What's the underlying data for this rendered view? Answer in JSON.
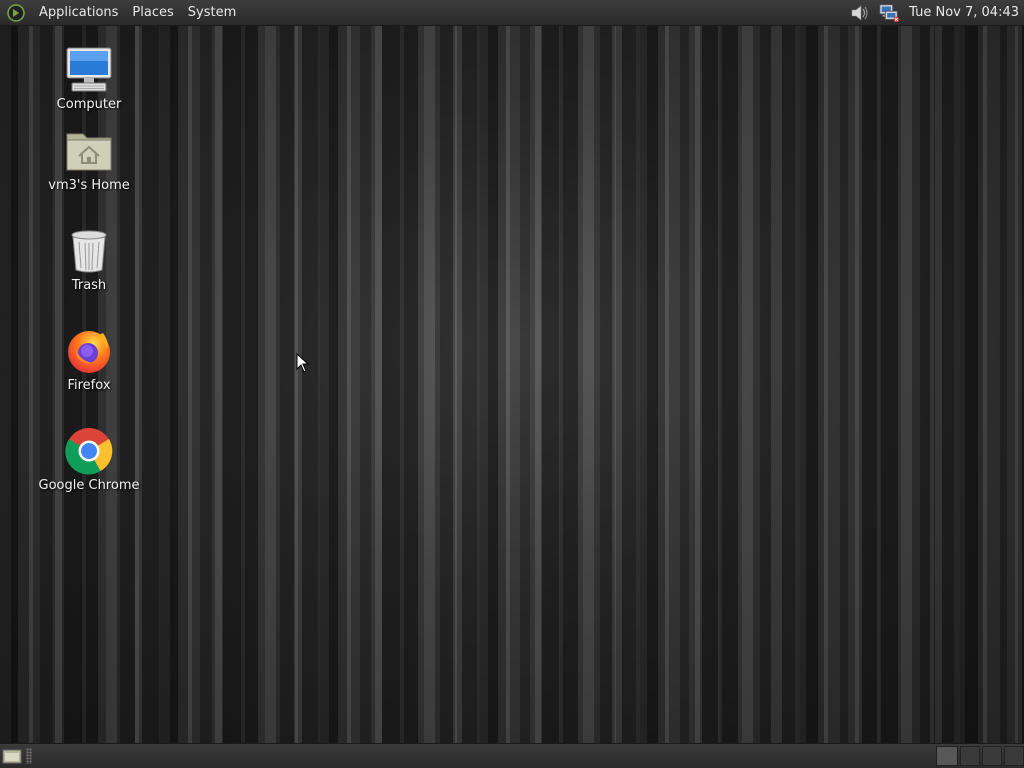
{
  "top_panel": {
    "menus": [
      "Applications",
      "Places",
      "System"
    ],
    "clock": "Tue Nov  7, 04:43",
    "tray_icons": [
      "volume-icon",
      "network-icon"
    ]
  },
  "desktop_icons": [
    {
      "label": "Computer",
      "icon": "computer-icon"
    },
    {
      "label": "vm3's Home",
      "icon": "home-folder-icon"
    },
    {
      "label": "Trash",
      "icon": "trash-icon"
    },
    {
      "label": "Firefox",
      "icon": "firefox-icon"
    },
    {
      "label": "Google Chrome",
      "icon": "chrome-icon"
    }
  ],
  "bottom_panel": {
    "workspaces_count": 4,
    "active_workspace": 1
  },
  "colors": {
    "panel_bg": "#2d2d2d",
    "text": "#e8e8e8"
  }
}
